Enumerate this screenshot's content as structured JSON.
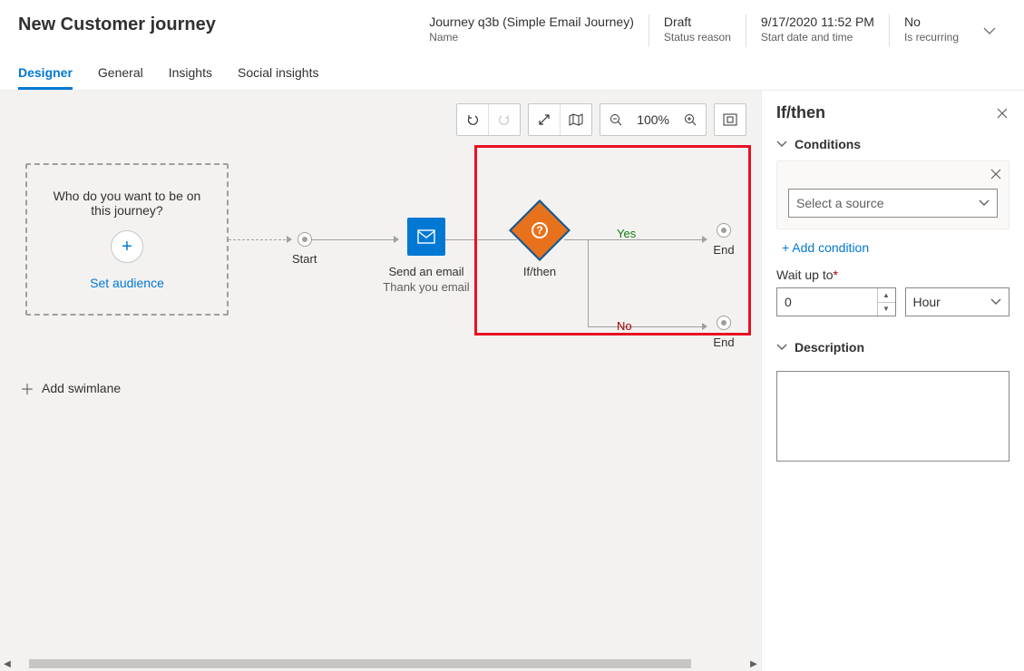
{
  "header": {
    "page_title": "New Customer journey",
    "meta": [
      {
        "value": "Journey q3b (Simple Email Journey)",
        "label": "Name"
      },
      {
        "value": "Draft",
        "label": "Status reason"
      },
      {
        "value": "9/17/2020 11:52 PM",
        "label": "Start date and time"
      },
      {
        "value": "No",
        "label": "Is recurring"
      }
    ]
  },
  "tabs": [
    "Designer",
    "General",
    "Insights",
    "Social insights"
  ],
  "toolbar": {
    "zoom_text": "100%"
  },
  "canvas": {
    "audience_question": "Who do you want to be on this journey?",
    "set_audience": "Set audience",
    "start_label": "Start",
    "email_title": "Send an email",
    "email_subtitle": "Thank you email",
    "ifthen_label": "If/then",
    "yes_label": "Yes",
    "no_label": "No",
    "end_label": "End",
    "add_swimlane": "Add swimlane"
  },
  "props": {
    "title": "If/then",
    "conditions_header": "Conditions",
    "source_placeholder": "Select a source",
    "add_condition": "+ Add condition",
    "wait_label": "Wait up to",
    "wait_value": "0",
    "wait_unit": "Hour",
    "description_header": "Description",
    "description_value": ""
  }
}
